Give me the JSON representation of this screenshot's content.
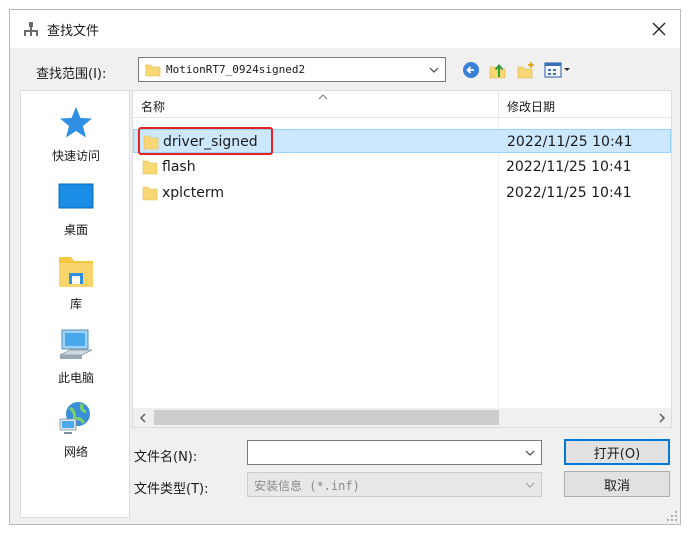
{
  "window": {
    "title": "查找文件"
  },
  "lookin": {
    "label": "查找范围(I):",
    "value": "MotionRT7_0924signed2"
  },
  "places": [
    {
      "label": "快速访问",
      "icon": "star-icon"
    },
    {
      "label": "桌面",
      "icon": "desktop-icon"
    },
    {
      "label": "库",
      "icon": "library-icon"
    },
    {
      "label": "此电脑",
      "icon": "computer-icon"
    },
    {
      "label": "网络",
      "icon": "network-icon"
    }
  ],
  "columns": {
    "name": "名称",
    "date": "修改日期"
  },
  "files": [
    {
      "name": "driver_signed",
      "date": "2022/11/25 10:41",
      "selected": true
    },
    {
      "name": "flash",
      "date": "2022/11/25 10:41",
      "selected": false
    },
    {
      "name": "xplcterm",
      "date": "2022/11/25 10:41",
      "selected": false
    }
  ],
  "filename": {
    "label": "文件名(N):",
    "value": ""
  },
  "filetype": {
    "label": "文件类型(T):",
    "value": "安装信息 (*.inf)"
  },
  "buttons": {
    "open": "打开(O)",
    "cancel": "取消"
  },
  "colors": {
    "selection": "#cce8ff",
    "highlight": "#e8201f",
    "primary_border": "#0078d7",
    "folder": "#f8d775"
  }
}
